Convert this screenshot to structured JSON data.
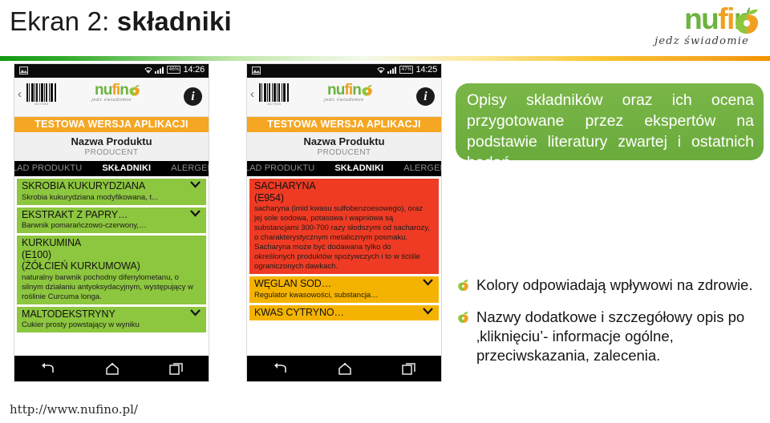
{
  "slide": {
    "title_plain": "Ekran 2: ",
    "title_bold": "składniki",
    "footer_url": "http://www.nufino.pl/"
  },
  "brand": {
    "name_part1": "nu",
    "name_part2": "fi",
    "name_part3": "n",
    "name_part4": "o",
    "tagline": "jedz świadomie",
    "green": "#6cb33f",
    "orange": "#f0a020"
  },
  "phones": [
    {
      "id": "phone-skladniki-green",
      "status": {
        "battery": "46%",
        "clock": "14:26"
      },
      "header": {
        "barcode_number": "8C7535",
        "info_label": "i"
      },
      "test_banner": "TESTOWA WERSJA APLIKACJI",
      "product_name": "Nazwa Produktu",
      "producer": "PRODUCENT",
      "tabs": [
        {
          "label": "SKŁAD PRODUKTU",
          "active": false
        },
        {
          "label": "SKŁADNIKI",
          "active": true
        },
        {
          "label": "ALERGENY",
          "active": false
        }
      ],
      "cards": [
        {
          "title": "SKROBIA KUKURYDZIANA",
          "desc": "Skrobia kukurydziana modyfikowana, t...",
          "color": "green",
          "chevron": true
        },
        {
          "title": "EKSTRAKT Z PAPRY…",
          "desc": "Barwnik pomarańczowo-czerwony,…",
          "color": "green",
          "chevron": true
        },
        {
          "title": "KURKUMINA\n(E100)\n(ŻÓŁCIEŃ KURKUMOWA)",
          "desc": "naturalny barwnik pochodny difenylometanu, o silnym działaniu antyoksydacyjnym, występujący w roślinie Curcuma longa.",
          "color": "green",
          "chevron": false
        },
        {
          "title": "MALTODEKSTRYNY",
          "desc": "Cukier prosty powstający w wyniku",
          "color": "green",
          "chevron": true
        }
      ]
    },
    {
      "id": "phone-skladniki-red",
      "status": {
        "battery": "47%",
        "clock": "14:25"
      },
      "header": {
        "barcode_number": "8C7535",
        "info_label": "i"
      },
      "test_banner": "TESTOWA WERSJA APLIKACJI",
      "product_name": "Nazwa Produktu",
      "producer": "PRODUCENT",
      "tabs": [
        {
          "label": "SKŁAD PRODUKTU",
          "active": false
        },
        {
          "label": "SKŁADNIKI",
          "active": true
        },
        {
          "label": "ALERGENY",
          "active": false
        }
      ],
      "cards": [
        {
          "title": "SACHARYNA\n(E954)",
          "desc": "sacharyna (imid kwasu sulfobenzoesowego), oraz jej sole sodowa, potasowa i wapniowa są substancjami 300-700 razy słodszymi od sacharozy, o charakterystycznym metalicznym posmaku. Sacharyna może być dodawana tylko do określonych produktów spożywczych i to w ściśle ograniczonych dawkach.",
          "color": "red",
          "chevron": false
        },
        {
          "title": "WĘGLAN SOD…",
          "desc": "Regulator kwasowości, substancja…",
          "color": "orange",
          "chevron": true
        },
        {
          "title": "KWAS CYTRYNO…",
          "desc": "",
          "color": "orange",
          "chevron": true
        }
      ]
    }
  ],
  "callout": {
    "text": "Opisy składników oraz ich ocena przygotowane przez ekspertów na podstawie literatury zwartej i ostatnich badań."
  },
  "bullets": [
    {
      "text": "Kolory odpowiadają wpływowi na zdrowie."
    },
    {
      "text": "Nazwy dodatkowe i szczegółowy opis po ‚kliknięciu’-  informacje ogólne, przeciwskazania, zalecenia."
    }
  ]
}
